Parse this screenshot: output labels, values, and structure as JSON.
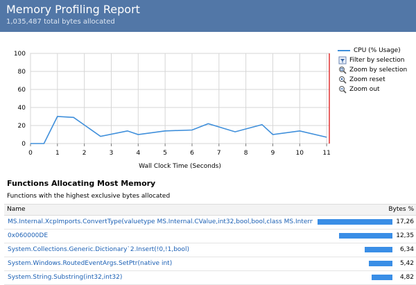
{
  "header": {
    "title": "Memory Profiling Report",
    "subtitle": "1,035,487 total bytes allocated"
  },
  "chart_data": {
    "type": "line",
    "xlabel": "Wall Clock Time (Seconds)",
    "ylabel": "",
    "xlim": [
      0,
      11.1
    ],
    "ylim": [
      0,
      100
    ],
    "xticks": [
      "0",
      "1",
      "2",
      "3",
      "4",
      "5",
      "6",
      "7",
      "8",
      "9",
      "10",
      "11"
    ],
    "yticks": [
      "100",
      "80",
      "60",
      "40",
      "20",
      "0"
    ],
    "series": [
      {
        "name": "CPU (% Usage)",
        "color": "#3f8fdb",
        "x": [
          0,
          0.5,
          1.0,
          1.6,
          2.6,
          3.6,
          4.0,
          5.0,
          6.0,
          6.6,
          7.6,
          8.6,
          9.0,
          10.0,
          11.0
        ],
        "values": [
          0,
          0,
          30,
          29,
          8,
          14,
          10,
          14,
          15,
          22,
          13,
          21,
          10,
          14,
          7
        ]
      }
    ],
    "marker_line_x": 11.1,
    "marker_line_color": "#e03030",
    "grid": true
  },
  "legend": {
    "series_label": "CPU (% Usage)",
    "actions": [
      {
        "label": "Filter by selection",
        "icon": "filter-icon"
      },
      {
        "label": "Zoom by selection",
        "icon": "zoom-selection-icon"
      },
      {
        "label": "Zoom reset",
        "icon": "zoom-reset-icon"
      },
      {
        "label": "Zoom out",
        "icon": "zoom-out-icon"
      }
    ]
  },
  "section": {
    "title": "Functions Allocating Most Memory",
    "subtitle": "Functions with the highest exclusive bytes allocated"
  },
  "table": {
    "columns": {
      "name": "Name",
      "bytes": "Bytes %"
    },
    "rows": [
      {
        "name": "MS.Internal.XcpImports.ConvertType(valuetype MS.Internal.CValue,int32,bool,bool,class MS.Internal.IManage...",
        "value": "17,26",
        "pct": 17.26
      },
      {
        "name": "0x060000DE",
        "value": "12,35",
        "pct": 12.35
      },
      {
        "name": "System.Collections.Generic.Dictionary`2.Insert(!0,!1,bool)",
        "value": "6,34",
        "pct": 6.34
      },
      {
        "name": "System.Windows.RoutedEventArgs.SetPtr(native int)",
        "value": "5,42",
        "pct": 5.42
      },
      {
        "name": "System.String.Substring(int32,int32)",
        "value": "4,82",
        "pct": 4.82
      }
    ]
  },
  "colors": {
    "header_bg": "#5277a7",
    "accent": "#3a8ee6",
    "link": "#1a5fb4"
  }
}
